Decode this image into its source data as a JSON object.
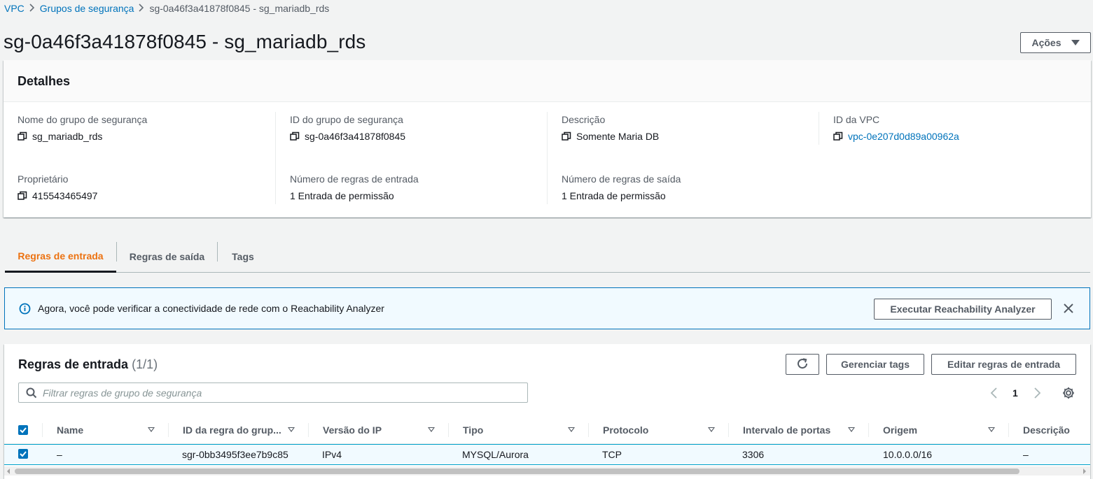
{
  "breadcrumb": {
    "items": [
      "VPC",
      "Grupos de segurança"
    ],
    "current": "sg-0a46f3a41878f0845 - sg_mariadb_rds"
  },
  "page": {
    "title": "sg-0a46f3a41878f0845 - sg_mariadb_rds",
    "actions_label": "Ações"
  },
  "details": {
    "title": "Detalhes",
    "fields": [
      {
        "label": "Nome do grupo de segurança",
        "value": "sg_mariadb_rds"
      },
      {
        "label": "ID do grupo de segurança",
        "value": "sg-0a46f3a41878f0845"
      },
      {
        "label": "Descrição",
        "value": "Somente Maria DB"
      },
      {
        "label": "ID da VPC",
        "value": "vpc-0e207d0d89a00962a"
      },
      {
        "label": "Proprietário",
        "value": "415543465497"
      },
      {
        "label": "Número de regras de entrada",
        "value": "1 Entrada de permissão"
      },
      {
        "label": "Número de regras de saída",
        "value": "1 Entrada de permissão"
      }
    ]
  },
  "tabs": [
    "Regras de entrada",
    "Regras de saída",
    "Tags"
  ],
  "banner": {
    "text": "Agora, você pode verificar a conectividade de rede com o Reachability Analyzer",
    "button": "Executar Reachability Analyzer"
  },
  "rules": {
    "title": "Regras de entrada",
    "count": "(1/1)",
    "manage_tags": "Gerenciar tags",
    "edit_rules": "Editar regras de entrada",
    "search_placeholder": "Filtrar regras de grupo de segurança",
    "page_number": "1",
    "columns": [
      "Name",
      "ID da regra do grup...",
      "Versão do IP",
      "Tipo",
      "Protocolo",
      "Intervalo de portas",
      "Origem",
      "Descrição"
    ],
    "rows": [
      [
        "–",
        "sgr-0bb3495f3ee7b9c85",
        "IPv4",
        "MYSQL/Aurora",
        "TCP",
        "3306",
        "10.0.0.0/16",
        "–"
      ]
    ]
  },
  "colors": {
    "accent_tab": "#ec7211",
    "link": "#0073bb",
    "banner_bg": "#f1faff"
  }
}
